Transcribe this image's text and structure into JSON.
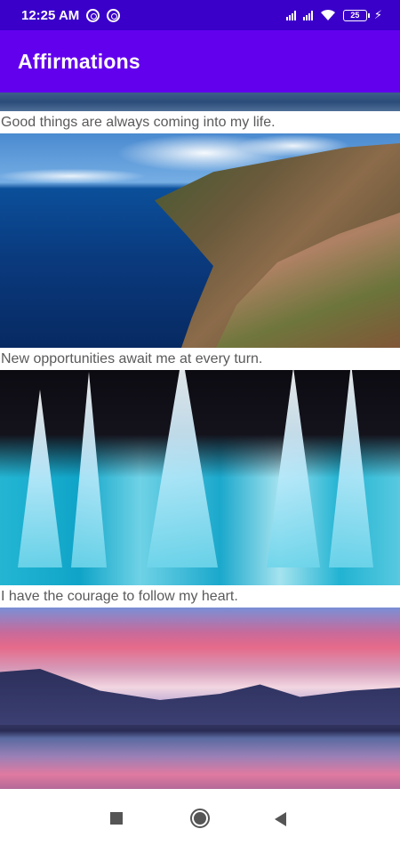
{
  "status_bar": {
    "time": "12:25 AM",
    "battery_level": "25",
    "icons": [
      "ring-icon",
      "ring-icon",
      "signal-icon",
      "signal-icon",
      "wifi-icon",
      "battery-icon",
      "bolt-icon"
    ]
  },
  "app_bar": {
    "title": "Affirmations",
    "background_color": "#6200ee",
    "status_color": "#3a00c9"
  },
  "feed": {
    "items": [
      {
        "caption": "Good things are always coming into my life.",
        "image": "sea-image"
      },
      {
        "caption": "New opportunities await me at every turn.",
        "image": "coastline-image"
      },
      {
        "caption": "I have the courage to follow my heart.",
        "image": "blue-crystal-image"
      },
      {
        "caption": "",
        "image": "sunset-lake-image"
      }
    ]
  },
  "nav_bar": {
    "buttons": [
      "recents-square-icon",
      "home-circle-icon",
      "back-triangle-icon"
    ]
  }
}
